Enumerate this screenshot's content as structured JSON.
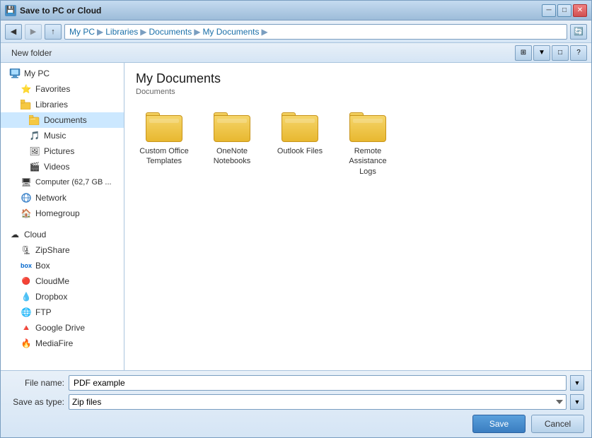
{
  "window": {
    "title": "Save to PC or Cloud",
    "icon": "💾"
  },
  "titlebar": {
    "buttons": {
      "minimize": "─",
      "maximize": "□",
      "close": "✕"
    }
  },
  "addressbar": {
    "back_tooltip": "Back",
    "forward_tooltip": "Forward",
    "up_tooltip": "Up",
    "breadcrumb": [
      "My PC",
      "Libraries",
      "Documents",
      "My Documents"
    ],
    "refresh_tooltip": "Refresh"
  },
  "toolbar": {
    "new_folder": "New folder",
    "view_options": [
      "⊞",
      "▼",
      "□",
      "?"
    ]
  },
  "sidebar": {
    "sections": [
      {
        "items": [
          {
            "id": "my-pc",
            "label": "My PC",
            "icon": "pc",
            "indent": 0
          },
          {
            "id": "favorites",
            "label": "Favorites",
            "icon": "star",
            "indent": 1
          },
          {
            "id": "libraries",
            "label": "Libraries",
            "icon": "folder",
            "indent": 1
          },
          {
            "id": "documents",
            "label": "Documents",
            "icon": "doc-folder",
            "indent": 2,
            "active": true
          },
          {
            "id": "music",
            "label": "Music",
            "icon": "music",
            "indent": 2
          },
          {
            "id": "pictures",
            "label": "Pictures",
            "icon": "image",
            "indent": 2
          },
          {
            "id": "videos",
            "label": "Videos",
            "icon": "video",
            "indent": 2
          },
          {
            "id": "computer",
            "label": "Computer (62,7 GB ...",
            "icon": "computer",
            "indent": 1
          },
          {
            "id": "network",
            "label": "Network",
            "icon": "network",
            "indent": 1
          },
          {
            "id": "homegroup",
            "label": "Homegroup",
            "icon": "homegroup",
            "indent": 1
          }
        ]
      },
      {
        "items": [
          {
            "id": "cloud",
            "label": "Cloud",
            "icon": "cloud",
            "indent": 0
          },
          {
            "id": "zipshare",
            "label": "ZipShare",
            "icon": "zip",
            "indent": 1
          },
          {
            "id": "box",
            "label": "Box",
            "icon": "box",
            "indent": 1
          },
          {
            "id": "cloudme",
            "label": "CloudMe",
            "icon": "cloudme",
            "indent": 1
          },
          {
            "id": "dropbox",
            "label": "Dropbox",
            "icon": "dropbox",
            "indent": 1
          },
          {
            "id": "ftp",
            "label": "FTP",
            "icon": "ftp",
            "indent": 1
          },
          {
            "id": "googledrive",
            "label": "Google Drive",
            "icon": "gdrive",
            "indent": 1
          },
          {
            "id": "mediafire",
            "label": "MediaFire",
            "icon": "mediafire",
            "indent": 1
          }
        ]
      }
    ]
  },
  "filearea": {
    "title": "My Documents",
    "subtitle": "Documents",
    "folders": [
      {
        "id": "custom-office",
        "label": "Custom Office Templates"
      },
      {
        "id": "onenote",
        "label": "OneNote Notebooks"
      },
      {
        "id": "outlook",
        "label": "Outlook Files"
      },
      {
        "id": "remote-assistance",
        "label": "Remote Assistance Logs"
      }
    ]
  },
  "bottombar": {
    "filename_label": "File name:",
    "filename_value": "PDF example",
    "saveas_label": "Save as type:",
    "saveas_value": "Zip files",
    "save_button": "Save",
    "cancel_button": "Cancel"
  }
}
